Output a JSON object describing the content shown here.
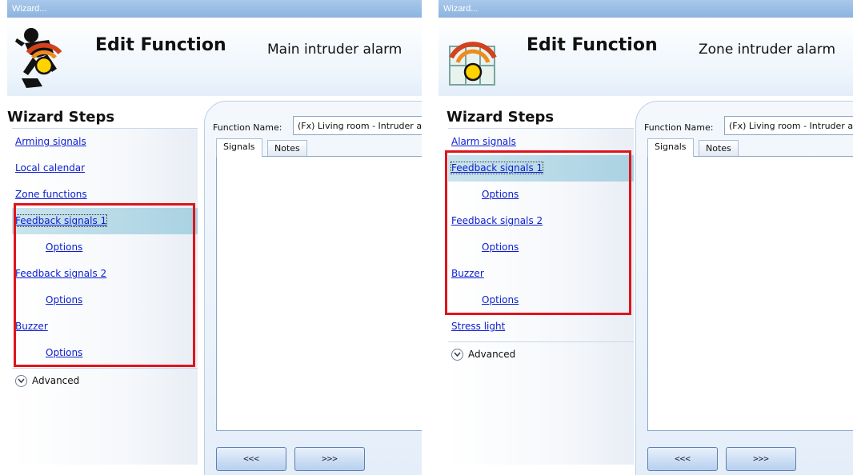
{
  "left": {
    "window_title": "Wizard...",
    "title": "Edit Function",
    "subtitle": "Main intruder alarm",
    "steps_title": "Wizard Steps",
    "steps": [
      {
        "label": "Arming signals",
        "sub": false,
        "active": false
      },
      {
        "label": "Local calendar",
        "sub": false,
        "active": false
      },
      {
        "label": "Zone functions",
        "sub": false,
        "active": false
      },
      {
        "label": "Feedback signals 1",
        "sub": false,
        "active": true
      },
      {
        "label": "Options",
        "sub": true,
        "active": false
      },
      {
        "label": "Feedback signals 2",
        "sub": false,
        "active": false
      },
      {
        "label": "Options",
        "sub": true,
        "active": false
      },
      {
        "label": "Buzzer",
        "sub": false,
        "active": false
      },
      {
        "label": "Options",
        "sub": true,
        "active": false
      }
    ],
    "advanced_label": "Advanced",
    "function_name_label": "Function Name:",
    "function_name_value": "(Fx) Living room - Intruder alarm",
    "tabs": [
      "Signals",
      "Notes"
    ],
    "prev_button": "<<<",
    "next_button": ">>>",
    "icon": "main-intruder-alarm-icon"
  },
  "right": {
    "window_title": "Wizard...",
    "title": "Edit Function",
    "subtitle": "Zone intruder alarm",
    "steps_title": "Wizard Steps",
    "steps": [
      {
        "label": "Alarm signals",
        "sub": false,
        "active": false
      },
      {
        "label": "Feedback signals 1",
        "sub": false,
        "active": true
      },
      {
        "label": "Options",
        "sub": true,
        "active": false
      },
      {
        "label": "Feedback signals 2",
        "sub": false,
        "active": false
      },
      {
        "label": "Options",
        "sub": true,
        "active": false
      },
      {
        "label": "Buzzer",
        "sub": false,
        "active": false
      },
      {
        "label": "Options",
        "sub": true,
        "active": false
      },
      {
        "label": "Stress light",
        "sub": false,
        "active": false
      }
    ],
    "advanced_label": "Advanced",
    "function_name_label": "Function Name:",
    "function_name_value": "(Fx) Living room - Intruder alarm",
    "tabs": [
      "Signals",
      "Notes"
    ],
    "prev_button": "<<<",
    "next_button": ">>>",
    "icon": "zone-intruder-alarm-icon"
  },
  "colors": {
    "highlight_box": "#e0141c",
    "link": "#0b1ed0",
    "titlebar": "#8cb4df"
  }
}
